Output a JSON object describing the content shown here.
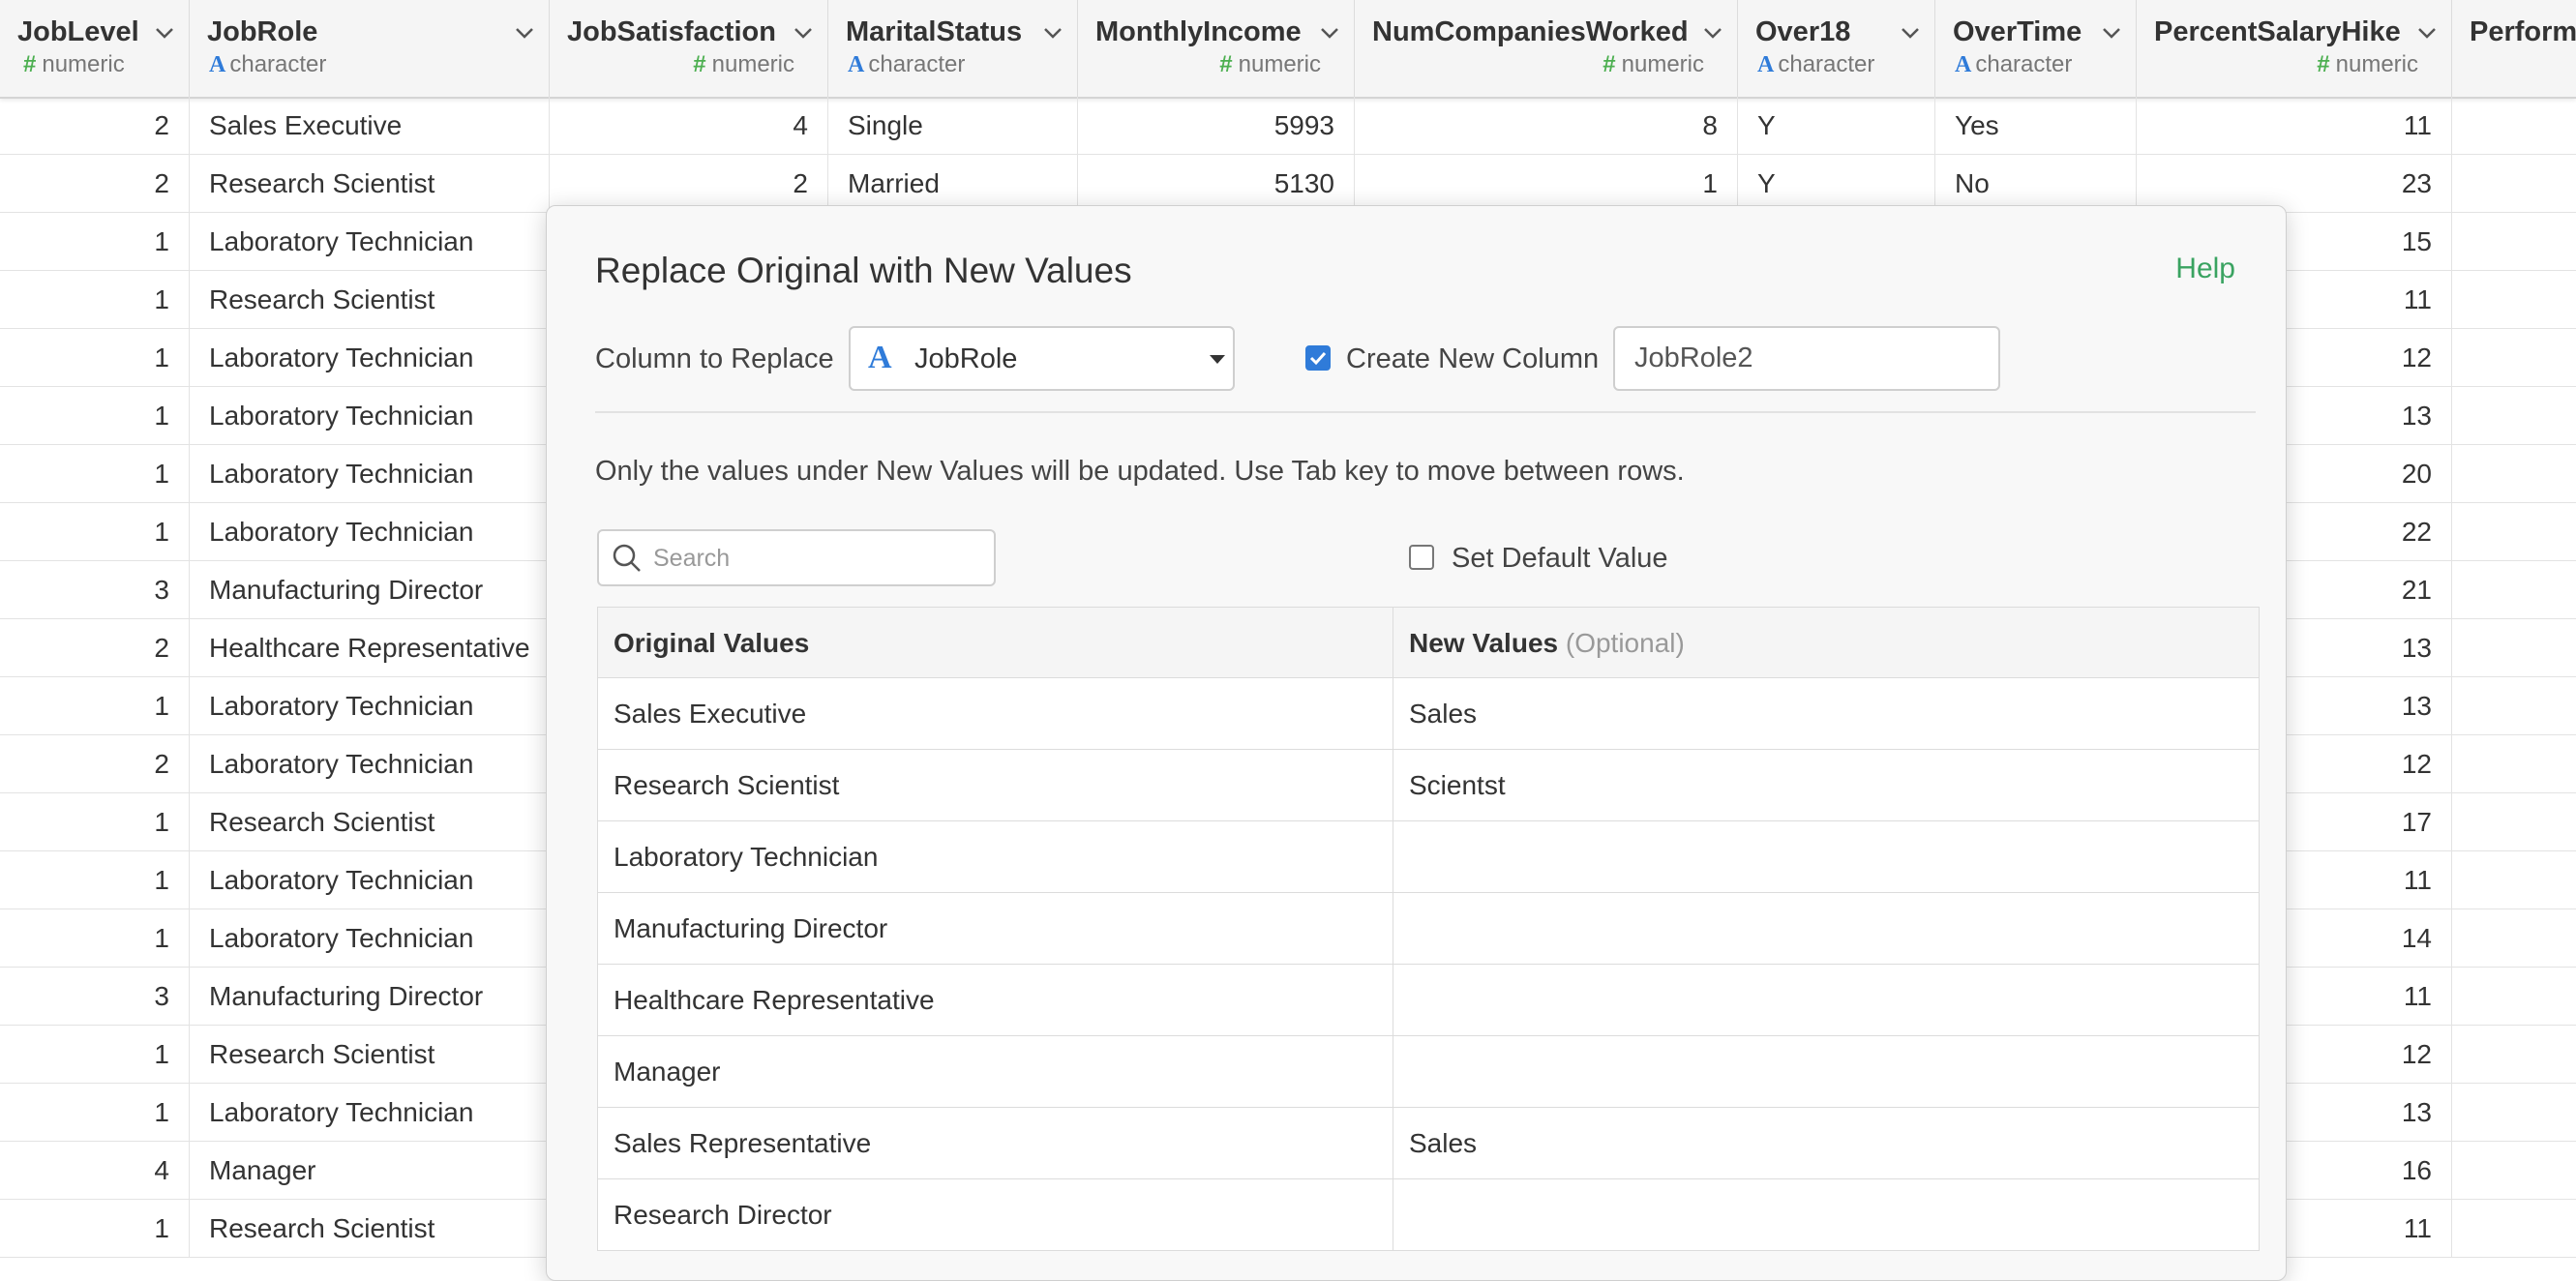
{
  "columns": [
    {
      "name": "JobLevel",
      "type": "numeric",
      "type_icon": "hash-icon"
    },
    {
      "name": "JobRole",
      "type": "character",
      "type_icon": "alpha-icon"
    },
    {
      "name": "JobSatisfaction",
      "type": "numeric",
      "type_icon": "hash-icon"
    },
    {
      "name": "MaritalStatus",
      "type": "character",
      "type_icon": "alpha-icon"
    },
    {
      "name": "MonthlyIncome",
      "type": "numeric",
      "type_icon": "hash-icon"
    },
    {
      "name": "NumCompaniesWorked",
      "type": "numeric",
      "type_icon": "hash-icon"
    },
    {
      "name": "Over18",
      "type": "character",
      "type_icon": "alpha-icon"
    },
    {
      "name": "OverTime",
      "type": "character",
      "type_icon": "alpha-icon"
    },
    {
      "name": "PercentSalaryHike",
      "type": "numeric",
      "type_icon": "hash-icon"
    },
    {
      "name": "Perform",
      "type": "",
      "type_icon": ""
    }
  ],
  "rows": [
    {
      "JobLevel": "2",
      "JobRole": "Sales Executive",
      "JobSatisfaction": "4",
      "MaritalStatus": "Single",
      "MonthlyIncome": "5993",
      "NumCompaniesWorked": "8",
      "Over18": "Y",
      "OverTime": "Yes",
      "PercentSalaryHike": "11"
    },
    {
      "JobLevel": "2",
      "JobRole": "Research Scientist",
      "JobSatisfaction": "2",
      "MaritalStatus": "Married",
      "MonthlyIncome": "5130",
      "NumCompaniesWorked": "1",
      "Over18": "Y",
      "OverTime": "No",
      "PercentSalaryHike": "23"
    },
    {
      "JobLevel": "1",
      "JobRole": "Laboratory Technician",
      "PercentSalaryHike": "15"
    },
    {
      "JobLevel": "1",
      "JobRole": "Research Scientist",
      "PercentSalaryHike": "11"
    },
    {
      "JobLevel": "1",
      "JobRole": "Laboratory Technician",
      "PercentSalaryHike": "12"
    },
    {
      "JobLevel": "1",
      "JobRole": "Laboratory Technician",
      "PercentSalaryHike": "13"
    },
    {
      "JobLevel": "1",
      "JobRole": "Laboratory Technician",
      "PercentSalaryHike": "20"
    },
    {
      "JobLevel": "1",
      "JobRole": "Laboratory Technician",
      "PercentSalaryHike": "22"
    },
    {
      "JobLevel": "3",
      "JobRole": "Manufacturing Director",
      "PercentSalaryHike": "21"
    },
    {
      "JobLevel": "2",
      "JobRole": "Healthcare Representative",
      "PercentSalaryHike": "13"
    },
    {
      "JobLevel": "1",
      "JobRole": "Laboratory Technician",
      "PercentSalaryHike": "13"
    },
    {
      "JobLevel": "2",
      "JobRole": "Laboratory Technician",
      "PercentSalaryHike": "12"
    },
    {
      "JobLevel": "1",
      "JobRole": "Research Scientist",
      "PercentSalaryHike": "17"
    },
    {
      "JobLevel": "1",
      "JobRole": "Laboratory Technician",
      "PercentSalaryHike": "11"
    },
    {
      "JobLevel": "1",
      "JobRole": "Laboratory Technician",
      "PercentSalaryHike": "14"
    },
    {
      "JobLevel": "3",
      "JobRole": "Manufacturing Director",
      "PercentSalaryHike": "11"
    },
    {
      "JobLevel": "1",
      "JobRole": "Research Scientist",
      "PercentSalaryHike": "12"
    },
    {
      "JobLevel": "1",
      "JobRole": "Laboratory Technician",
      "PercentSalaryHike": "13"
    },
    {
      "JobLevel": "4",
      "JobRole": "Manager",
      "PercentSalaryHike": "16"
    },
    {
      "JobLevel": "1",
      "JobRole": "Research Scientist",
      "PercentSalaryHike": "11"
    }
  ],
  "dialog": {
    "title": "Replace Original with New Values",
    "help": "Help",
    "column_label": "Column to Replace",
    "column_value": "JobRole",
    "create_new_label": "Create New Column",
    "create_new_checked": true,
    "new_column_name": "JobRole2",
    "instructions": "Only the values under New Values will be updated. Use Tab key to move between rows.",
    "search_placeholder": "Search",
    "default_value_label": "Set Default Value",
    "default_value_checked": false,
    "table_headers": {
      "original": "Original Values",
      "new": "New Values",
      "new_hint": "(Optional)"
    },
    "mappings": [
      {
        "original": "Sales Executive",
        "new": "Sales"
      },
      {
        "original": "Research Scientist",
        "new": "Scientst"
      },
      {
        "original": "Laboratory Technician",
        "new": ""
      },
      {
        "original": "Manufacturing Director",
        "new": ""
      },
      {
        "original": "Healthcare Representative",
        "new": ""
      },
      {
        "original": "Manager",
        "new": ""
      },
      {
        "original": "Sales Representative",
        "new": "Sales"
      },
      {
        "original": "Research Director",
        "new": ""
      }
    ]
  },
  "colors": {
    "accent_green": "#3aa361",
    "type_blue": "#2f7bd9",
    "type_green": "#4caf50"
  }
}
